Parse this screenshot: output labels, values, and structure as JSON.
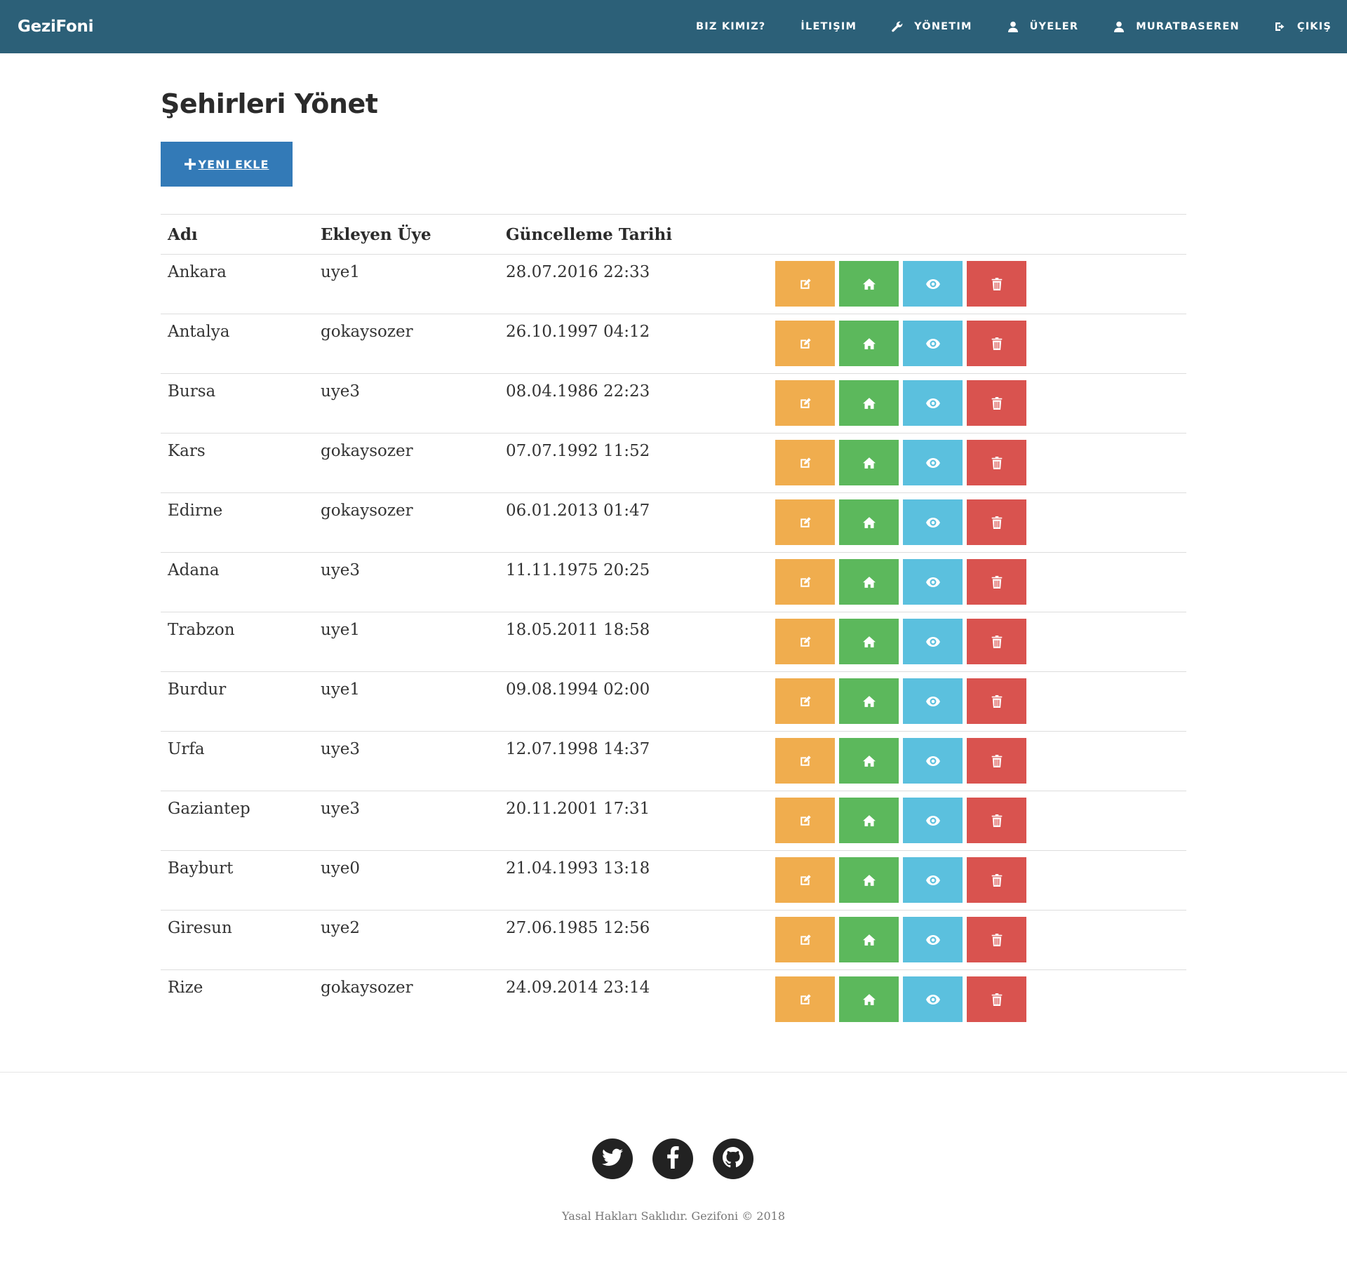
{
  "brand": "GeziFoni",
  "nav": [
    {
      "label": "BIZ KIMIZ?",
      "icon": ""
    },
    {
      "label": "İLETIŞIM",
      "icon": ""
    },
    {
      "label": "YÖNETIM",
      "icon": "wrench-icon"
    },
    {
      "label": "ÜYELER",
      "icon": "user-icon"
    },
    {
      "label": "MURATBASEREN",
      "icon": "user-icon"
    },
    {
      "label": "ÇIKIŞ",
      "icon": "logout-icon"
    }
  ],
  "page": {
    "title": "Şehirleri Yönet",
    "add_button": "YENI EKLE"
  },
  "table": {
    "headers": [
      "Adı",
      "Ekleyen Üye",
      "Güncelleme Tarihi"
    ],
    "rows": [
      {
        "name": "Ankara",
        "member": "uye1",
        "date": "28.07.2016 22:33"
      },
      {
        "name": "Antalya",
        "member": "gokaysozer",
        "date": "26.10.1997 04:12"
      },
      {
        "name": "Bursa",
        "member": "uye3",
        "date": "08.04.1986 22:23"
      },
      {
        "name": "Kars",
        "member": "gokaysozer",
        "date": "07.07.1992 11:52"
      },
      {
        "name": "Edirne",
        "member": "gokaysozer",
        "date": "06.01.2013 01:47"
      },
      {
        "name": "Adana",
        "member": "uye3",
        "date": "11.11.1975 20:25"
      },
      {
        "name": "Trabzon",
        "member": "uye1",
        "date": "18.05.2011 18:58"
      },
      {
        "name": "Burdur",
        "member": "uye1",
        "date": "09.08.1994 02:00"
      },
      {
        "name": "Urfa",
        "member": "uye3",
        "date": "12.07.1998 14:37"
      },
      {
        "name": "Gaziantep",
        "member": "uye3",
        "date": "20.11.2001 17:31"
      },
      {
        "name": "Bayburt",
        "member": "uye0",
        "date": "21.04.1993 13:18"
      },
      {
        "name": "Giresun",
        "member": "uye2",
        "date": "27.06.1985 12:56"
      },
      {
        "name": "Rize",
        "member": "gokaysozer",
        "date": "24.09.2014 23:14"
      }
    ],
    "actions": [
      {
        "name": "edit",
        "icon": "edit-icon",
        "color": "#f0ad4e"
      },
      {
        "name": "home",
        "icon": "home-icon",
        "color": "#5cb85c"
      },
      {
        "name": "view",
        "icon": "eye-icon",
        "color": "#5bc0de"
      },
      {
        "name": "delete",
        "icon": "trash-icon",
        "color": "#d9534f"
      }
    ]
  },
  "footer": {
    "social": [
      "twitter-icon",
      "facebook-icon",
      "github-icon"
    ],
    "copyright": "Yasal Hakları Saklıdır. Gezifoni © 2018"
  },
  "colors": {
    "navbar": "#2c6078",
    "primary": "#337ab7",
    "warning": "#f0ad4e",
    "success": "#5cb85c",
    "info": "#5bc0de",
    "danger": "#d9534f"
  }
}
